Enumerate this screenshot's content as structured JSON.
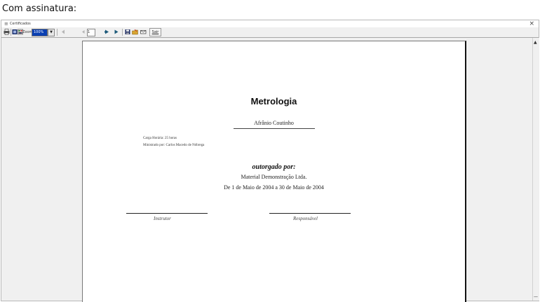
{
  "caption": "Com assinatura:",
  "window": {
    "title": "Certificados",
    "close_glyph": "×"
  },
  "toolbar": {
    "zoom_label": "Zoom:",
    "zoom_value": "100%",
    "page_number": "1",
    "sair_label": "Sair",
    "icons": [
      "print-icon",
      "grid-icon",
      "export-icon",
      "first-page-icon",
      "prev-page-icon",
      "next-page-icon",
      "last-page-icon",
      "save-icon",
      "open-folder-icon",
      "email-icon"
    ]
  },
  "certificate": {
    "title": "Metrologia",
    "student": "Afrânio Coutinho",
    "carga_horaria": "Carga Horária: 25 horas",
    "ministrado_por": "Ministrado por: Carlos Macedo de Nóbrega",
    "outorgado": "outorgado por:",
    "empresa": "Material Demonstração Ltda.",
    "periodo": "De 1 de Maio de 2004 a 30 de Maio de 2004",
    "instrutor_label": "Instrutor",
    "responsavel_label": "Responsável"
  }
}
